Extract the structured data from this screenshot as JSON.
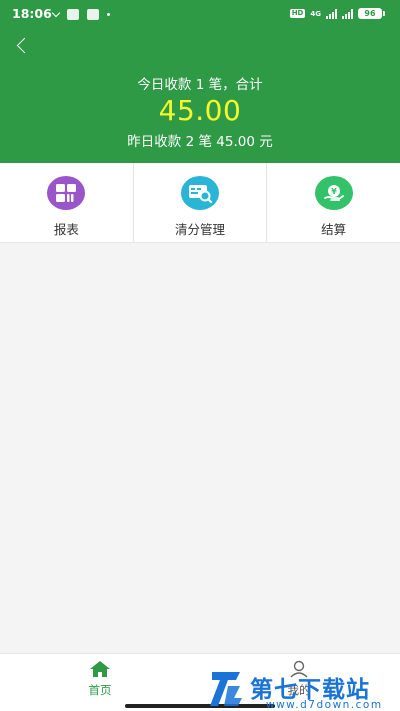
{
  "status_bar": {
    "time": "18:06",
    "hd": "HD",
    "network": "4G",
    "battery": "96"
  },
  "header": {
    "today_summary": "今日收款 1 笔，合计",
    "today_amount": "45.00",
    "yesterday_summary": "昨日收款 2 笔 45.00 元"
  },
  "actions": [
    {
      "label": "报表",
      "icon": "report-grid-icon",
      "color": "#9a55c9"
    },
    {
      "label": "清分管理",
      "icon": "card-search-icon",
      "color": "#29b6d6"
    },
    {
      "label": "结算",
      "icon": "settlement-icon",
      "color": "#33c26a"
    }
  ],
  "tabbar": {
    "home_label": "首页",
    "mine_label": "我的",
    "active_color": "#2f9a45"
  },
  "watermark": {
    "title": "第七下载站",
    "url": "www.d7down.com",
    "color": "#1a73d6"
  }
}
